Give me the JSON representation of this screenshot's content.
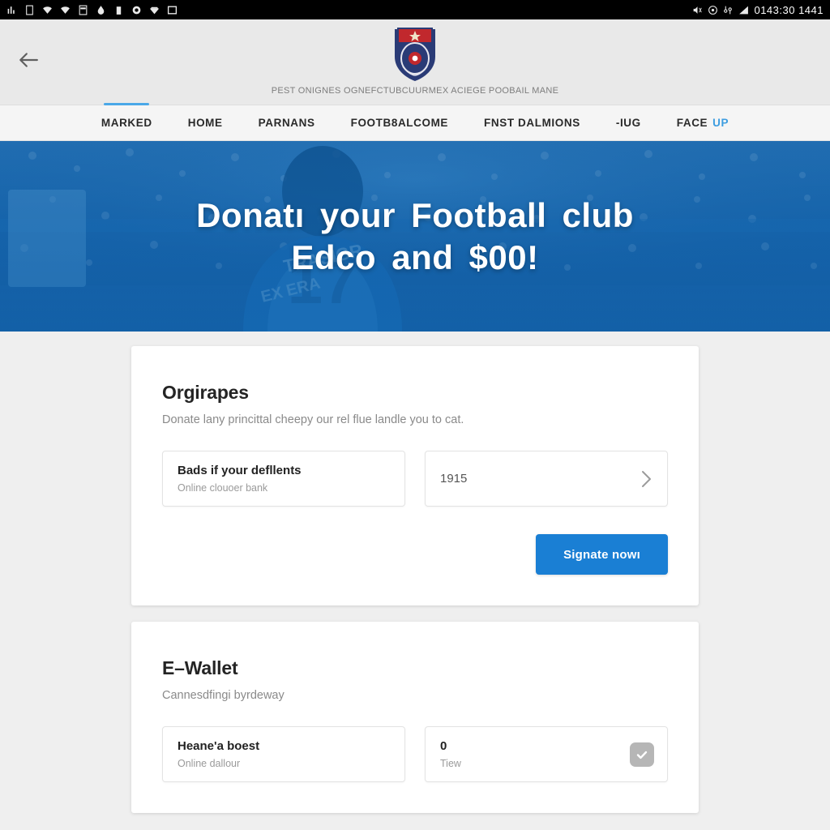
{
  "statusbar": {
    "left_icons": [
      "signal-icon",
      "sim-card-icon",
      "wifi-icon",
      "wifi-alt-icon",
      "calculator-icon",
      "water-drop-icon",
      "battery-icon",
      "record-icon",
      "diamond-icon",
      "square-icon"
    ],
    "right_icons": [
      "volume-icon",
      "target-icon",
      "vpn-icon",
      "signal-bars-icon"
    ],
    "time": "0143:30 1441"
  },
  "header": {
    "back_icon": "back-arrow-icon",
    "logo_alt": "football-club-crest",
    "tagline": "PEST ONIGNES OGNEFCTUBCUURMEX ACIEGE POOBAIL MANE"
  },
  "nav": {
    "items": [
      {
        "label": "MARKED",
        "active": true
      },
      {
        "label": "HOME",
        "active": false
      },
      {
        "label": "PARNANS",
        "active": false
      },
      {
        "label": "FOOTB8ALCOME",
        "active": false
      },
      {
        "label": "FNST DALMIONS",
        "active": false
      },
      {
        "label": "-IUG",
        "active": false
      }
    ],
    "last": {
      "label": "FACE",
      "accent": "UP"
    }
  },
  "hero": {
    "line1": "Donatı your  Football  club",
    "line2": "Edco  and  $00!"
  },
  "cards": [
    {
      "title": "Orgirapes",
      "subtitle": "Donate lany princittal cheepy our rel flue landle you to cat.",
      "fields": [
        {
          "main": "Bads if your defllents",
          "sub": "Online clouoer bank",
          "accessory": "none"
        },
        {
          "main": "1915",
          "sub": "",
          "accessory": "chevron"
        }
      ],
      "button": {
        "label": "Signate nowı",
        "color": "#1a7fd4"
      }
    },
    {
      "title": "E–Wallet",
      "subtitle": "Cannesdfingi byrdeway",
      "fields": [
        {
          "main": "Heane'a boest",
          "sub": "Online dallour",
          "accessory": "none"
        },
        {
          "main": "0",
          "sub": "Tiew",
          "accessory": "checkbox"
        }
      ]
    }
  ],
  "colors": {
    "accent": "#1a7fd4",
    "nav_active": "#4aa8e8",
    "page_bg": "#efefef",
    "hero_blue": "#1565b5"
  }
}
